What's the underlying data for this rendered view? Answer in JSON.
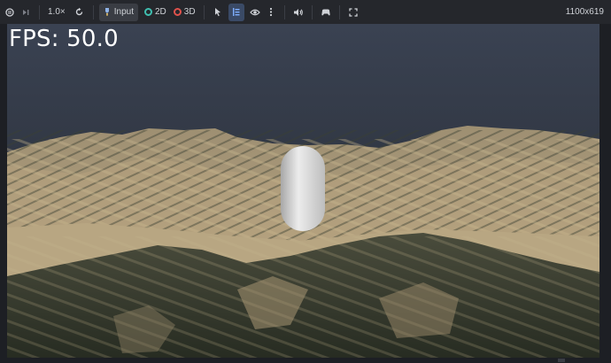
{
  "toolbar": {
    "speed_label": "1.0×",
    "input_label": "Input",
    "mode_2d_label": "2D",
    "mode_3d_label": "3D",
    "resolution_label": "1100x619",
    "icons": [
      "pause-icon",
      "step-icon",
      "reload-icon",
      "input-icon",
      "pointer-icon",
      "list-icon",
      "eye-icon",
      "more-icon",
      "speaker-icon",
      "controller-icon",
      "fullscreen-icon"
    ],
    "colors": {
      "mode_2d": "#3fbfb0",
      "mode_3d": "#e0524c",
      "active_bg": "#3a4a66"
    }
  },
  "viewport": {
    "fps_text": "FPS: 50.0",
    "sky_top": "#3a4252",
    "sky_bottom": "#1f2228",
    "terrain_light": "#b9a683",
    "terrain_dark": "#2b3127",
    "capsule_color": "#d8d8d8"
  }
}
